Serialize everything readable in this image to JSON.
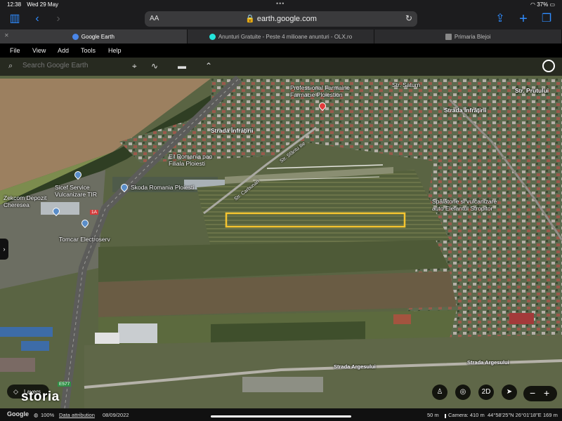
{
  "status_bar": {
    "time": "12:38",
    "date": "Wed 29 May",
    "battery": "37%"
  },
  "browser": {
    "aa_label": "AA",
    "url": "earth.google.com",
    "tabs": [
      {
        "title": "Google Earth",
        "active": true
      },
      {
        "title": "Anunturi Gratuite - Peste 4 milioane anunturi - OLX.ro",
        "active": false
      },
      {
        "title": "Primaria Blejoi",
        "active": false
      }
    ]
  },
  "earth_menu": {
    "items": [
      "File",
      "View",
      "Add",
      "Tools",
      "Help"
    ]
  },
  "search": {
    "placeholder": "Search Google Earth"
  },
  "map_labels": {
    "top_road": "Str. Saturn",
    "top_right": "Str. Prutului",
    "professional": "Professional Farmaine\nFarmacie Ploiestion",
    "infratirii_1": "Strada Înfrățirii",
    "infratirii_2": "Strada Înfrățirii",
    "str_diag": "Str. Sfântu Ilie",
    "str_diag2": "Str. Carbunari",
    "eil": "Eil Romania pao\nFiliala Ploiesti",
    "sicef": "Sicef Service\nVulcanizare TIR",
    "skoda": "Skoda Romania Ploiesti",
    "zekcom": "Zekcom Depozit Cheresea",
    "tomcar": "Tomcar Electroserv",
    "spalatorie": "Spălătorie si vulcanizare\nauto Elefantul Stropitor",
    "argesului_1": "Strada Argesului",
    "argesului_2": "Strada Argesului",
    "dn1a": "1A",
    "e577": "E577"
  },
  "controls": {
    "layers_label": "Layers",
    "mode_label": "2D",
    "watermark": "storia"
  },
  "footer": {
    "google": "Google",
    "zoom_pct": "100%",
    "attribution": "Data attribution",
    "date": "08/09/2022",
    "scale": "50 m",
    "camera": "Camera: 410 m",
    "coords": "44°58'25\"N 26°01'18\"E",
    "elevation": "169 m"
  },
  "colors": {
    "highlight_box": "#f4c430",
    "accent": "#2f8cff"
  }
}
